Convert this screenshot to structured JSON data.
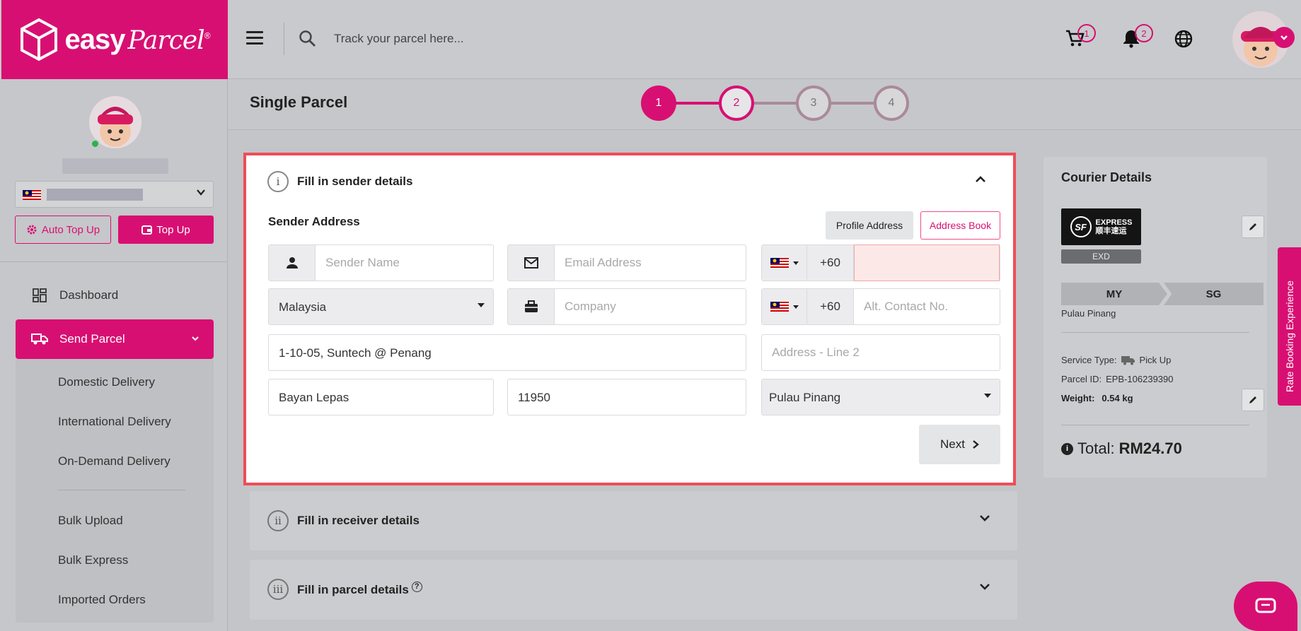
{
  "brand": {
    "name": "easy",
    "script": "Parcel",
    "reg": "®",
    "color": "#d80f72"
  },
  "sidebar": {
    "auto_topup_label": "Auto Top Up",
    "topup_label": "Top Up",
    "nav": {
      "dashboard": "Dashboard",
      "send_parcel": "Send Parcel",
      "sub": [
        "Domestic Delivery",
        "International Delivery",
        "On-Demand Delivery",
        "Bulk Upload",
        "Bulk Express",
        "Imported Orders"
      ]
    }
  },
  "header": {
    "search_placeholder": "Track your parcel here...",
    "cart_count": "1",
    "notif_count": "2"
  },
  "page": {
    "title": "Single Parcel",
    "steps": [
      "1",
      "2",
      "3",
      "4"
    ],
    "current_step": 2
  },
  "sender": {
    "section_num": "i",
    "section_title": "Fill in sender details",
    "address_label": "Sender Address",
    "profile_btn": "Profile Address",
    "address_book_btn": "Address Book",
    "name_placeholder": "Sender Name",
    "email_placeholder": "Email Address",
    "phone_code": "+60",
    "country": "Malaysia",
    "company_placeholder": "Company",
    "alt_code": "+60",
    "alt_placeholder": "Alt. Contact No.",
    "address1": "1-10-05, Suntech @ Penang",
    "address2_placeholder": "Address - Line 2",
    "city": "Bayan Lepas",
    "postcode": "11950",
    "state": "Pulau Pinang",
    "next_btn": "Next"
  },
  "receiver": {
    "section_num": "ii",
    "section_title": "Fill in receiver details"
  },
  "parcel": {
    "section_num": "iii",
    "section_title": "Fill in parcel details"
  },
  "courier": {
    "title": "Courier Details",
    "logo_mark": "SF",
    "logo_text_1": "EXPRESS",
    "logo_text_2": "顺丰速运",
    "service_code": "EXD",
    "from": "MY",
    "to": "SG",
    "origin_state": "Pulau Pinang",
    "service_type_label": "Service Type:",
    "service_type": "Pick Up",
    "parcel_id_label": "Parcel ID:",
    "parcel_id": "EPB-106239390",
    "weight_label": "Weight:",
    "weight": "0.54 kg",
    "total_label": "Total:",
    "total": "RM24.70"
  },
  "rate_tab": "Rate Booking Experience"
}
